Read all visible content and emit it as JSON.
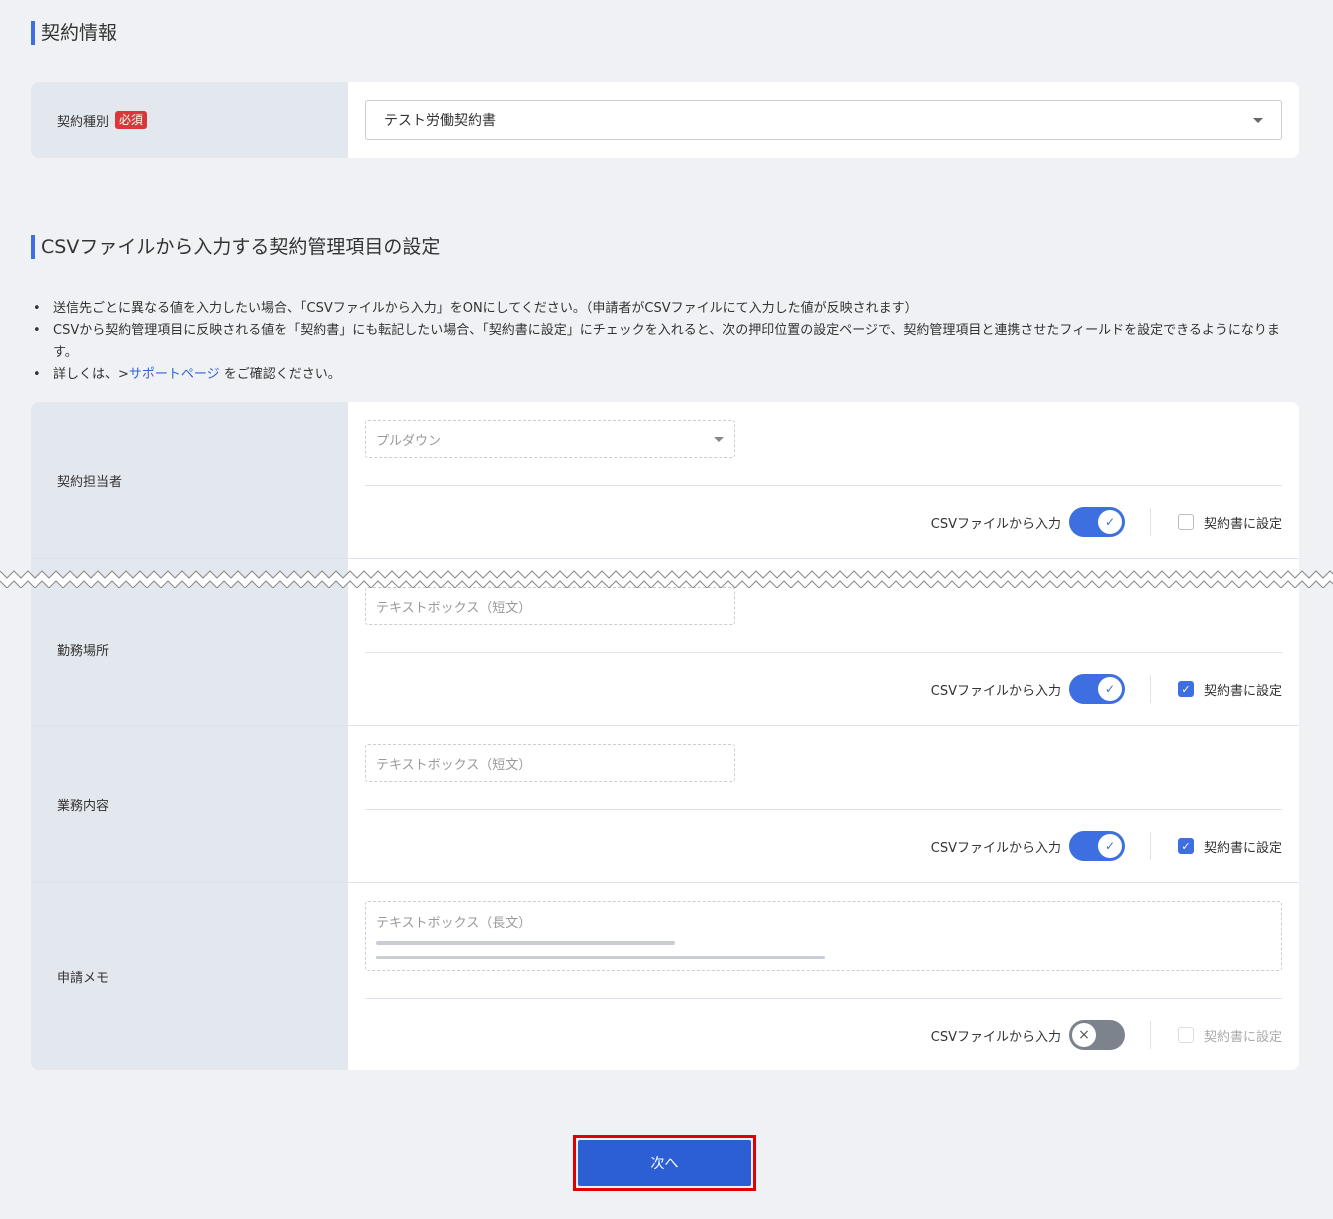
{
  "contract_info": {
    "title": "契約情報",
    "type_label": "契約種別",
    "required_badge": "必須",
    "type_value": "テスト労働契約書"
  },
  "csv_section": {
    "title": "CSVファイルから入力する契約管理項目の設定",
    "notes": [
      "送信先ごとに異なる値を入力したい場合、「CSVファイルから入力」をONにしてください。（申請者がCSVファイルにて入力した値が反映されます）",
      "CSVから契約管理項目に反映される値を「契約書」にも転記したい場合、「契約書に設定」にチェックを入れると、次の押印位置の設定ページで、契約管理項目と連携させたフィールドを設定できるようになります。"
    ],
    "note3_prefix": "詳しくは、>",
    "note3_link": "サポートページ",
    "note3_suffix": "をご確認ください。",
    "csv_toggle_label": "CSVファイルから入力",
    "set_contract_label": "契約書に設定",
    "rows": [
      {
        "label": "契約担当者",
        "placeholder": "プルダウン",
        "csv_on": true,
        "set_contract": false
      },
      {
        "label": "勤務場所",
        "placeholder": "テキストボックス（短文）",
        "csv_on": true,
        "set_contract": true
      },
      {
        "label": "業務内容",
        "placeholder": "テキストボックス（短文）",
        "csv_on": true,
        "set_contract": true
      },
      {
        "label": "申請メモ",
        "placeholder": "テキストボックス（長文）",
        "csv_on": false,
        "set_contract": false
      }
    ]
  },
  "next_button": "次へ",
  "colors": {
    "accent": "#3d6fe0",
    "required": "#d93838",
    "highlight_border": "#e00000"
  }
}
